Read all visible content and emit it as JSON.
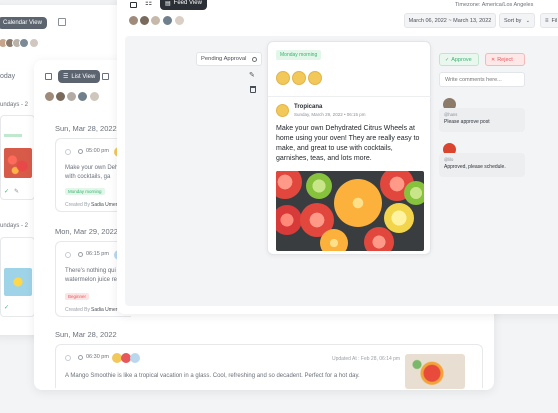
{
  "back_calendar": {
    "view_label": "Calendar View",
    "day_label": "oday",
    "date_rows": [
      "undays - 2",
      "undays - 2"
    ]
  },
  "list_view": {
    "view_label": "List View",
    "group_label": "undays - 2",
    "groups": [
      {
        "date": "Sun, Mar 28, 2022",
        "time": "05:00 pm",
        "text": "Make your own Deh with cocktails, ga",
        "tag": "Monday morning",
        "created_by": "Created By",
        "creator": "Sadia Umer"
      },
      {
        "date": "Mon, Mar 29, 2022",
        "time": "06:15 pm",
        "text": "There's nothing qui watermelon juice re",
        "tag": "Beginner",
        "created_by": "Created By",
        "creator": "Sadia Umer"
      },
      {
        "date": "Sun, Mar 28, 2022",
        "time": "06:30 pm",
        "updated": "Updated At : Feb 28, 06:14 pm",
        "text": "A Mango Smoothie is like a tropical vacation in a glass. Cool, refreshing and so decadent. Perfect for a hot day."
      }
    ]
  },
  "feed_view": {
    "view_label": "Feed View",
    "timezone": "Timezone: America/Los Angeles",
    "date_range": "March 06, 2022 ~ March 13, 2022",
    "sort_label": "Sort by",
    "filter_label": "Fil",
    "status_label": "Pending Approval",
    "campaign_tag": "Monday morning",
    "approve_label": "Approve",
    "reject_label": "Reject",
    "comment_placeholder": "Write comments here...",
    "post": {
      "account": "Tropicana",
      "datetime": "Sunday, March 29, 2022 • 06:15 pm",
      "caption": "Make your own Dehydrated Citrus Wheels at home using your oven! They are really easy to make, and great to use with cocktails, garnishes, teas, and lots more."
    },
    "comments": [
      {
        "handle": "@hans",
        "text": "Please approve post"
      },
      {
        "handle": "@lilo",
        "text": "Approved, please schedule."
      }
    ]
  },
  "colors": {
    "accent_green": "#3cb371",
    "reject_red": "#e8585b",
    "dark_button": "#5c6470"
  }
}
